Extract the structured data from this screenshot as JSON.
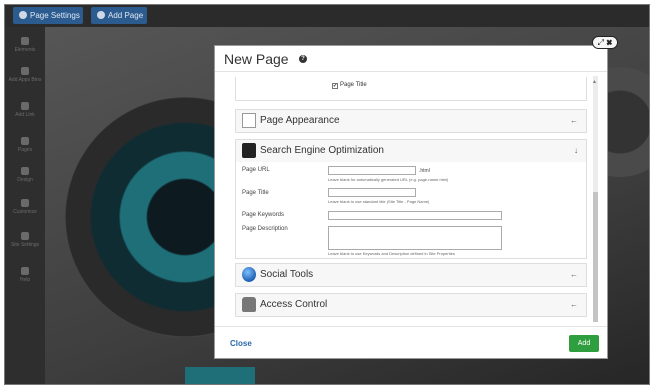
{
  "toolbar": {
    "settings_label": "Page Settings",
    "addpage_label": "Add Page"
  },
  "sidebar": {
    "items": [
      {
        "label": "Elements",
        "icon": "grid-icon"
      },
      {
        "label": "Add Apps Btns",
        "icon": "plus-icon"
      },
      {
        "label": "Add Link",
        "icon": "plus-icon"
      },
      {
        "label": "Pages",
        "icon": "list-icon"
      },
      {
        "label": "Design",
        "icon": "monitor-icon"
      },
      {
        "label": "Customize",
        "icon": "drop-icon"
      },
      {
        "label": "Site Settings",
        "icon": "gear-icon"
      },
      {
        "label": "Help",
        "icon": "question-icon"
      }
    ]
  },
  "modal": {
    "title": "New Page",
    "help_icon": "question-circle-icon",
    "controls": "⤢ ✖",
    "page_title_checkbox": "Page Title",
    "panels": {
      "appearance": "Page Appearance",
      "seo": "Search Engine Optimization",
      "social": "Social Tools",
      "access": "Access Control"
    },
    "seo": {
      "url_label": "Page URL",
      "url_suffix": ".html",
      "url_help": "Leave blank for automatically generated URL (e.g. page-name.html)",
      "title_label": "Page Title",
      "title_help": "Leave blank to use standard title (Site Title - Page Name)",
      "keywords_label": "Page Keywords",
      "description_label": "Page Description",
      "description_help": "Leave blank to use Keywords and Description defined in Site Properties"
    },
    "footer": {
      "close_label": "Close",
      "add_label": "Add"
    }
  },
  "colors": {
    "primary_button": "#2f9e3e",
    "link": "#2a6aa8",
    "toolbar_button": "#2c5b8f"
  }
}
